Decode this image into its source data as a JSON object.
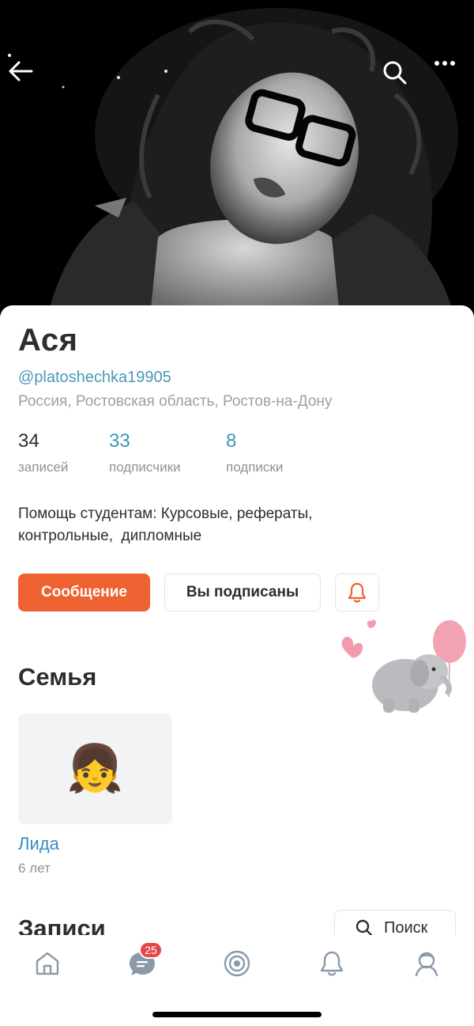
{
  "profile": {
    "name": "Ася",
    "handle": "@platoshechka19905",
    "location": "Россия, Ростовская область, Ростов-на-Дону",
    "bio_line1": "Помощь студентам: Курсовые, рефераты,",
    "bio_line2": "контрольные,  дипломные"
  },
  "stats": [
    {
      "value": "34",
      "label": "записей"
    },
    {
      "value": "33",
      "label": "подписчики"
    },
    {
      "value": "8",
      "label": "подписки"
    }
  ],
  "actions": {
    "message": "Сообщение",
    "subscribed": "Вы подписаны"
  },
  "family": {
    "title": "Семья",
    "members": [
      {
        "name": "Лида",
        "age": "6 лет",
        "emoji": "👧"
      }
    ]
  },
  "posts": {
    "title": "Записи",
    "search": "Поиск"
  },
  "tabbar": {
    "messages_badge": "25",
    "items": [
      "home-icon",
      "messages-icon",
      "discover-icon",
      "notifications-icon",
      "profile-icon"
    ]
  },
  "colors": {
    "accent": "#ee6131",
    "link": "#3d97b6",
    "badge": "#e64646"
  }
}
